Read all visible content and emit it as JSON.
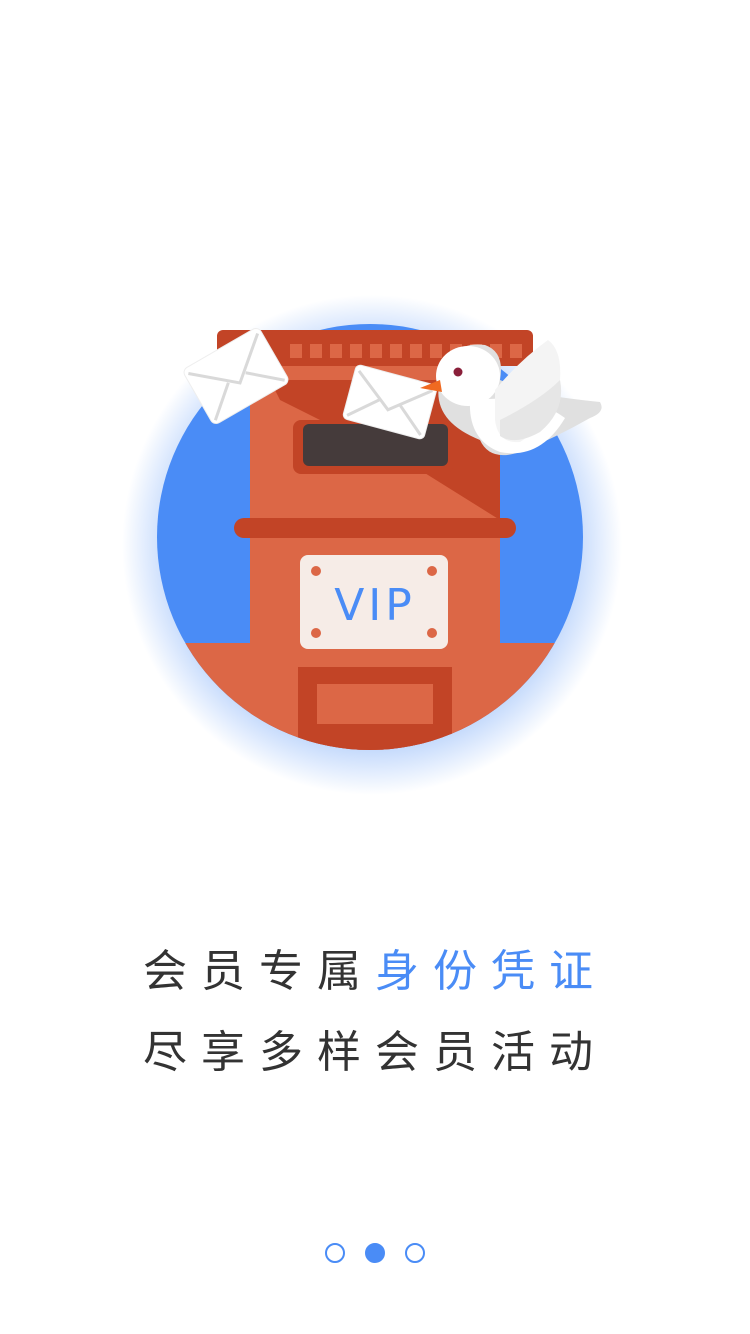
{
  "illustration": {
    "badge_text": "VIP",
    "colors": {
      "circle_bg": "#4a8cf6",
      "mailbox_body": "#dc6746",
      "mailbox_dark": "#c24426",
      "slot": "#453b3b",
      "plate": "#f6ece7",
      "plate_text": "#4a8cf6",
      "envelope": "#ffffff",
      "bird": "#ffffff",
      "bird_beak": "#f06a21"
    }
  },
  "headline": {
    "line1_prefix": "会员专属",
    "line1_highlight": "身份凭证",
    "line2": "尽享多样会员活动"
  },
  "pager": {
    "count": 3,
    "active_index": 1
  }
}
